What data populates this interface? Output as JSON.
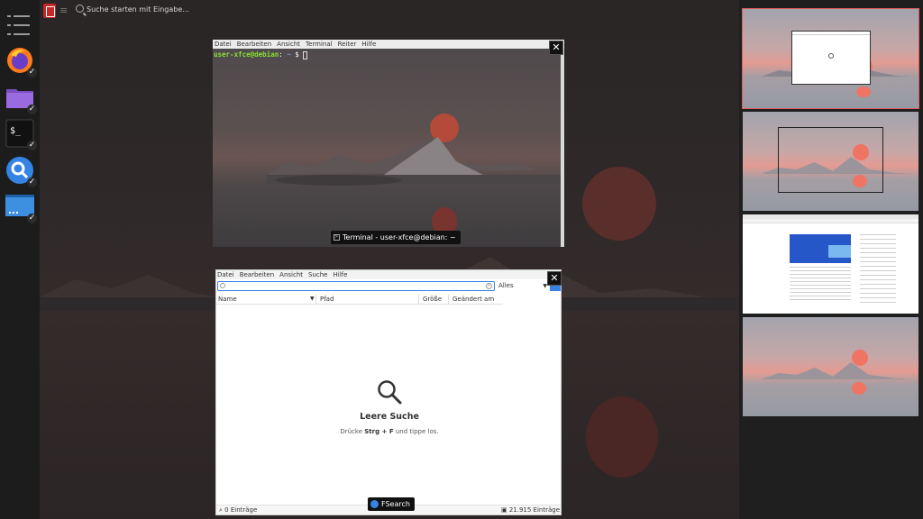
{
  "topbar": {
    "search_placeholder": "Suche starten mit Eingabe..."
  },
  "dock": {
    "items": [
      {
        "name": "menu",
        "icon": "hamburger-menu-icon"
      },
      {
        "name": "firefox",
        "icon": "firefox-icon"
      },
      {
        "name": "files",
        "icon": "folder-icon"
      },
      {
        "name": "terminal",
        "icon": "terminal-icon",
        "glyph": "$_"
      },
      {
        "name": "fsearch",
        "icon": "magnifier-icon"
      },
      {
        "name": "desktop",
        "icon": "desktop-icon"
      }
    ]
  },
  "terminal": {
    "menu": [
      "Datei",
      "Bearbeiten",
      "Ansicht",
      "Terminal",
      "Reiter",
      "Hilfe"
    ],
    "prompt_user": "user-xfce@debian",
    "prompt_sep": ":",
    "prompt_path": " ~",
    "prompt_symbol": " $ ",
    "title": "Terminal - user-xfce@debian: ~",
    "close_glyph": "✕"
  },
  "fsearch": {
    "menu": [
      "Datei",
      "Bearbeiten",
      "Ansicht",
      "Suche",
      "Hilfe"
    ],
    "filter_value": "Alles",
    "columns": [
      "Name",
      "Pfad",
      "Größe",
      "Geändert am"
    ],
    "empty_title": "Leere Suche",
    "empty_hint_pre": "Drücke ",
    "empty_hint_keys": "Strg + F",
    "empty_hint_post": " und tippe los.",
    "status_left": "0 Einträge",
    "status_right": "21.915 Einträge",
    "title": "FSearch",
    "close_glyph": "✕"
  },
  "workspaces": {
    "count": 4,
    "active_index": 0
  },
  "colors": {
    "accent_red": "#c62828",
    "prompt_green": "#8ae234",
    "prompt_blue": "#729fcf",
    "fsearch_blue": "#3584e4"
  }
}
